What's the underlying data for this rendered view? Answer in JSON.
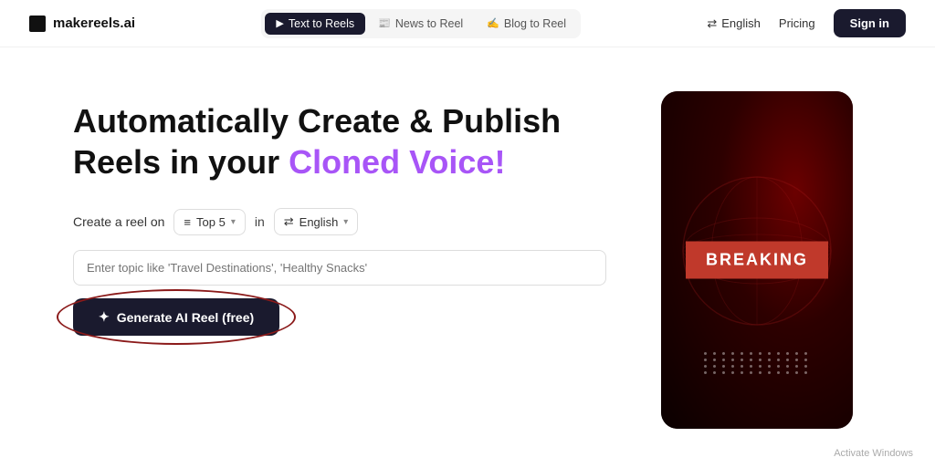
{
  "nav": {
    "logo_text": "makereels.ai",
    "tabs": [
      {
        "id": "text-to-reels",
        "label": "Text to Reels",
        "icon": "▶",
        "active": true
      },
      {
        "id": "news-to-reel",
        "label": "News to Reel",
        "icon": "📰",
        "active": false
      },
      {
        "id": "blog-to-reel",
        "label": "Blog to Reel",
        "icon": "✍",
        "active": false
      }
    ],
    "lang_label": "English",
    "pricing_label": "Pricing",
    "signin_label": "Sign in"
  },
  "hero": {
    "title_line1": "Automatically Create & Publish",
    "title_line2_normal": "Reels in your ",
    "title_line2_accent": "Cloned Voice!"
  },
  "controls": {
    "create_label": "Create a reel on",
    "dropdown_icon": "≡",
    "dropdown_value": "Top 5",
    "in_label": "in",
    "lang_icon": "⇄",
    "lang_value": "English"
  },
  "topic_input": {
    "placeholder": "Enter topic like 'Travel Destinations', 'Healthy Snacks'"
  },
  "generate_btn": {
    "icon": "✦",
    "label": "Generate AI Reel (free)"
  },
  "breaking_card": {
    "text": "BREAKING"
  },
  "watermark": {
    "text": "Activate Windows"
  }
}
